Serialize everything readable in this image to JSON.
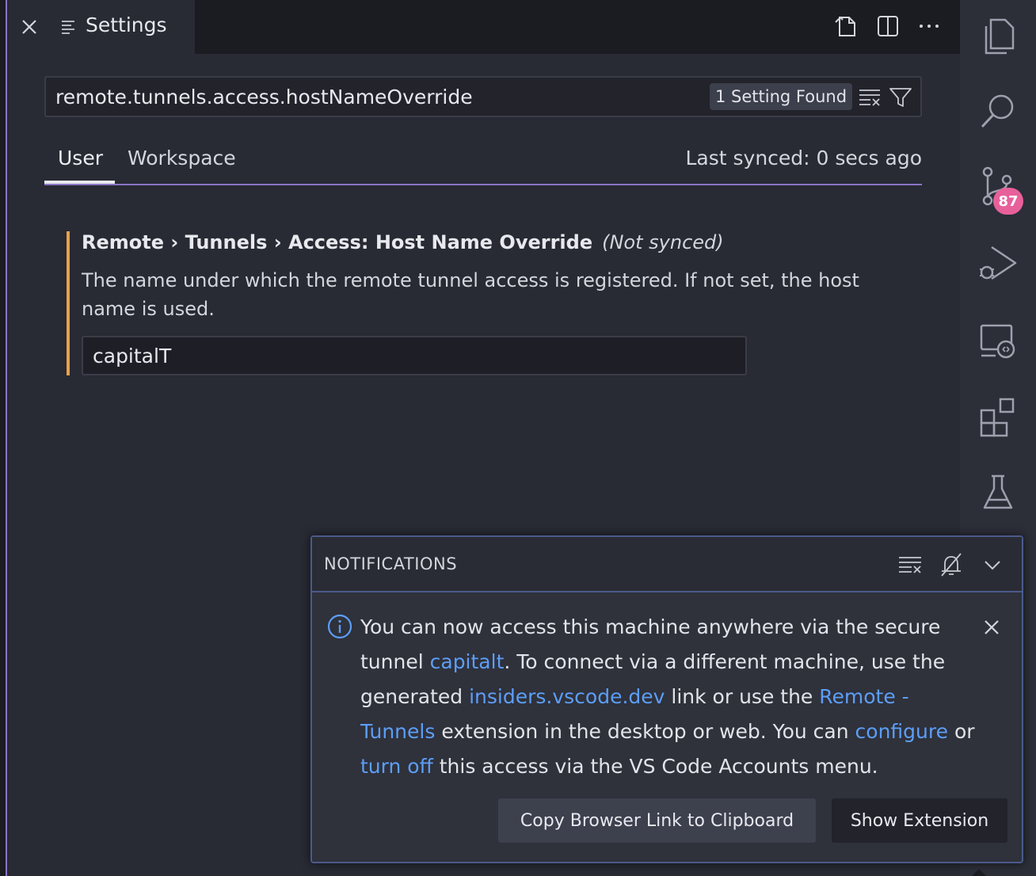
{
  "tab": {
    "label": "Settings"
  },
  "search": {
    "value": "remote.tunnels.access.hostNameOverride",
    "found_badge": "1 Setting Found"
  },
  "scope_tabs": {
    "user": "User",
    "workspace": "Workspace",
    "last_synced": "Last synced: 0 secs ago"
  },
  "setting": {
    "title": "Remote › Tunnels › Access: Host Name Override",
    "not_synced": "(Not synced)",
    "description": "The name under which the remote tunnel access is registered. If not set, the host name is used.",
    "value": "capitalT"
  },
  "activity_bar": {
    "source_control_badge": "87",
    "items": [
      "files-icon",
      "search-icon",
      "source-control-icon",
      "run-debug-icon",
      "remote-explorer-icon",
      "extensions-icon",
      "testing-icon"
    ]
  },
  "notifications": {
    "title": "NOTIFICATIONS",
    "message": {
      "part1": "You can now access this machine anywhere via the secure tunnel ",
      "link_tunnel": "capitalt",
      "part2": ". To connect via a different machine, use the generated ",
      "link_insiders": "insiders.vscode.dev",
      "part3": " link or use the ",
      "link_extension": "Remote - Tunnels",
      "part4": " extension in the desktop or web. You can ",
      "link_configure": "configure",
      "part5": " or ",
      "link_turnoff": "turn off",
      "part6": " this access via the VS Code Accounts menu."
    },
    "buttons": {
      "copy": "Copy Browser Link to Clipboard",
      "show": "Show Extension"
    }
  },
  "colors": {
    "accent": "#8c75c4",
    "link": "#5c9ef7",
    "badge": "#e8609a",
    "modified_bar": "#e8a04a"
  }
}
